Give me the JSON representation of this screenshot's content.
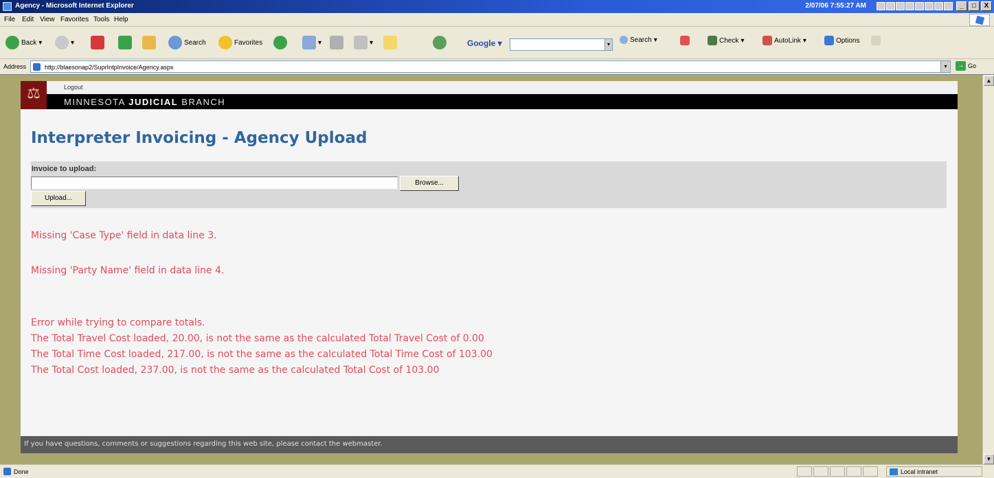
{
  "window": {
    "title": "Agency - Microsoft Internet Explorer",
    "clock": "2/07/06 7:55:27 AM",
    "buttons": [
      "_",
      "□",
      "X"
    ]
  },
  "menubar": {
    "items": [
      "File",
      "Edit",
      "View",
      "Favorites",
      "Tools",
      "Help"
    ]
  },
  "toolbar": {
    "back_label": "Back",
    "search_label": "Search",
    "favorites_label": "Favorites",
    "google_label": "Google",
    "google_search_label": "Search",
    "check_label": "Check",
    "autolink_label": "AutoLink",
    "options_label": "Options"
  },
  "address": {
    "label": "Address",
    "url": "http://blaesonap2/SuprIntpInvoice/Agency.aspx",
    "go_label": "Go"
  },
  "page": {
    "logout": "Logout",
    "brand_prefix": "MINNESOTA ",
    "brand_bold": "JUDICIAL",
    "brand_suffix": " BRANCH",
    "heading": "Interpreter Invoicing - Agency Upload",
    "upload": {
      "label": "Invoice to upload:",
      "browse_label": "Browse...",
      "upload_label": "Upload..."
    },
    "messages": [
      "Missing 'Case Type' field in data line 3.",
      "Missing 'Party Name' field in data line 4.",
      "Error while trying to compare totals.",
      "The Total Travel Cost loaded, 20.00, is not the same as the calculated Total Travel Cost of 0.00",
      "The Total Time Cost loaded, 217.00, is not the same as the calculated Total Time Cost of 103.00",
      "The Total Cost loaded, 237.00, is not the same as the calculated Total Cost of 103.00"
    ],
    "footer": "If you have questions, comments or suggestions regarding this web site, please contact the webmaster."
  },
  "statusbar": {
    "status": "Done",
    "zone": "Local intranet"
  },
  "colors": {
    "error": "#e24b59",
    "heading": "#2f66a0",
    "brand_bg": "#000000",
    "seal_bg": "#7a1212",
    "page_border": "#a9a76d"
  }
}
